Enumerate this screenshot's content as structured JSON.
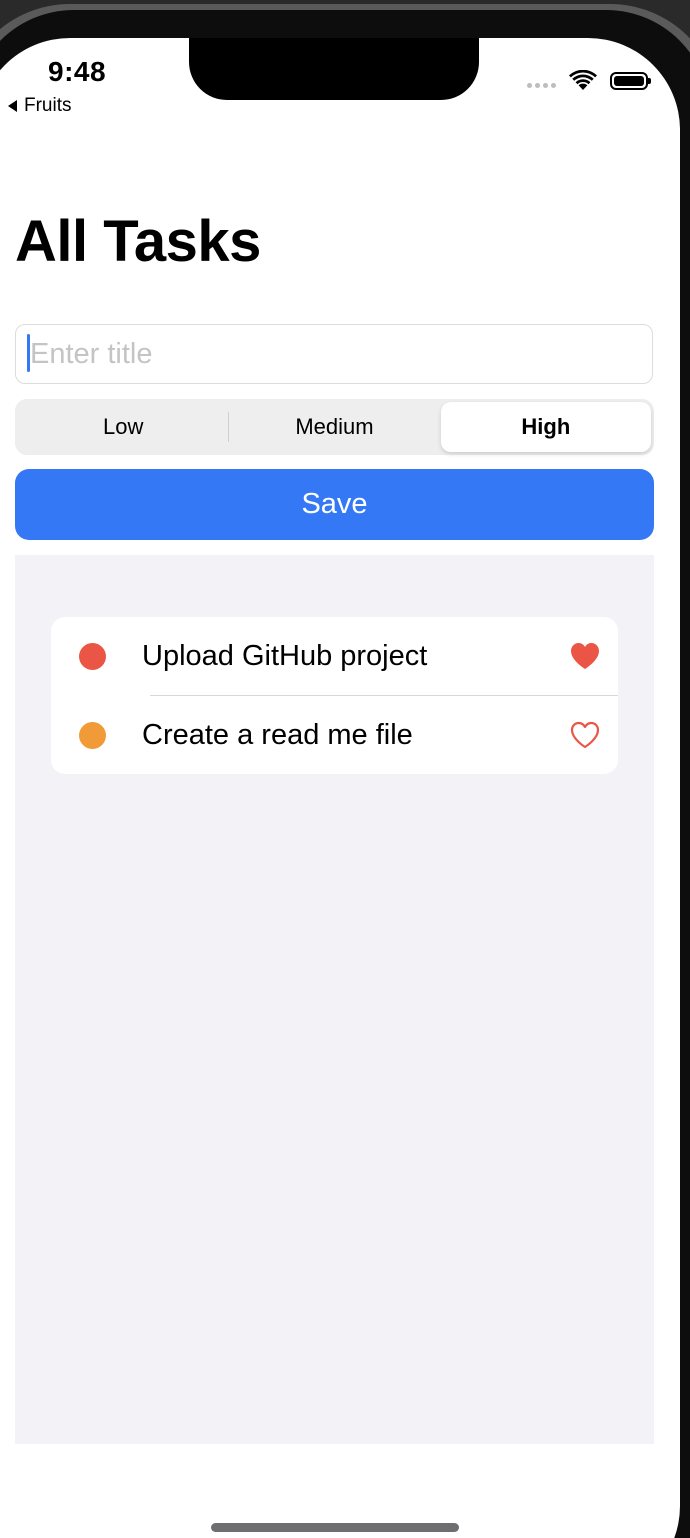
{
  "status_bar": {
    "time": "9:48",
    "back_label": "Fruits"
  },
  "page": {
    "title": "All Tasks"
  },
  "form": {
    "title_placeholder": "Enter title",
    "title_value": "",
    "priority_options": [
      "Low",
      "Medium",
      "High"
    ],
    "selected_priority": "High",
    "save_label": "Save"
  },
  "tasks": [
    {
      "title": "Upload GitHub project",
      "priority_color": "#eb5545",
      "favorite": true
    },
    {
      "title": "Create a read me file",
      "priority_color": "#f19a38",
      "favorite": false
    }
  ],
  "colors": {
    "accent": "#3478f6",
    "high": "#eb5545",
    "medium": "#f19a38",
    "heart": "#eb5545",
    "list_background": "#f2f2f7"
  }
}
